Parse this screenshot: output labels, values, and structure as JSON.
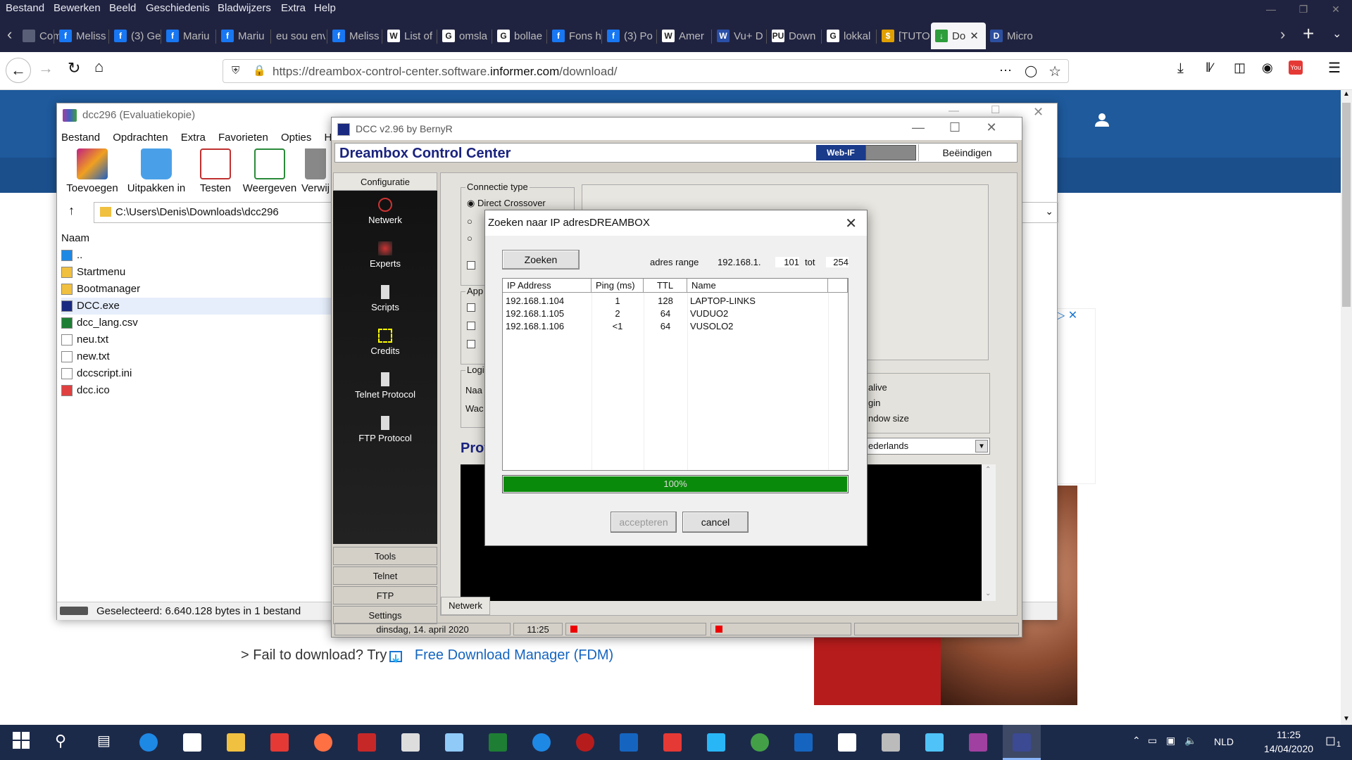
{
  "browser": {
    "menu": [
      "Bestand",
      "Bewerken",
      "Beeld",
      "Geschiedenis",
      "Bladwijzers",
      "Extra",
      "Help"
    ],
    "tabs": [
      {
        "label": "Comp",
        "icon": "page-icon",
        "color": "#5a5f78"
      },
      {
        "label": "Meliss",
        "icon": "facebook-icon",
        "color": "#1877f2"
      },
      {
        "label": "(3) Ge",
        "icon": "facebook-icon",
        "color": "#1877f2"
      },
      {
        "label": "Mariu",
        "icon": "facebook-icon",
        "color": "#1877f2"
      },
      {
        "label": "Mariu",
        "icon": "facebook-icon",
        "color": "#1877f2"
      },
      {
        "label": "eu sou env",
        "icon": "none",
        "color": "#202340"
      },
      {
        "label": "Meliss",
        "icon": "facebook-icon",
        "color": "#1877f2"
      },
      {
        "label": "List of",
        "icon": "wikipedia-icon",
        "color": "#ffffff"
      },
      {
        "label": "omsla",
        "icon": "google-icon",
        "color": "#ffffff"
      },
      {
        "label": "bollae",
        "icon": "google-icon",
        "color": "#ffffff"
      },
      {
        "label": "Fons h",
        "icon": "facebook-icon",
        "color": "#1877f2"
      },
      {
        "label": "(3) Po",
        "icon": "facebook-icon",
        "color": "#1877f2"
      },
      {
        "label": "Amer",
        "icon": "wikipedia-icon",
        "color": "#ffffff"
      },
      {
        "label": "Vu+ D",
        "icon": "vu-icon",
        "color": "#2a4fa8"
      },
      {
        "label": "Down",
        "icon": "pu-icon",
        "color": "#ffffff"
      },
      {
        "label": "lokkal",
        "icon": "google-icon",
        "color": "#ffffff"
      },
      {
        "label": "[TUTO",
        "icon": "coin-icon",
        "color": "#e0a000"
      },
      {
        "label": "Do",
        "icon": "download-icon",
        "color": "#2e9d3c",
        "active": true
      },
      {
        "label": "Micro",
        "icon": "dcc-icon",
        "color": "#2d4fa0"
      }
    ],
    "url_prefix": "https://dreambox-control-center.software.",
    "url_domain": "informer.com",
    "url_path": "/download/"
  },
  "page": {
    "fail_prefix": "> Fail to download? Try",
    "fdm_link": "Free Download Manager (FDM)"
  },
  "winrar": {
    "title": "dcc296 (Evaluatiekopie)",
    "menu": [
      "Bestand",
      "Opdrachten",
      "Extra",
      "Favorieten",
      "Opties",
      "Help"
    ],
    "toolbar": [
      "Toevoegen",
      "Uitpakken in",
      "Testen",
      "Weergeven",
      "Verwij"
    ],
    "path": "C:\\Users\\Denis\\Downloads\\dcc296",
    "column_name": "Naam",
    "files": [
      {
        "name": "..",
        "icon": "up-arrow-icon"
      },
      {
        "name": "Startmenu",
        "icon": "folder-icon"
      },
      {
        "name": "Bootmanager",
        "icon": "folder-icon"
      },
      {
        "name": "DCC.exe",
        "icon": "exe-icon",
        "selected": true
      },
      {
        "name": "dcc_lang.csv",
        "icon": "excel-icon"
      },
      {
        "name": "neu.txt",
        "icon": "text-file-icon"
      },
      {
        "name": "new.txt",
        "icon": "text-file-icon"
      },
      {
        "name": "dccscript.ini",
        "icon": "ini-file-icon"
      },
      {
        "name": "dcc.ico",
        "icon": "image-file-icon"
      }
    ],
    "status": "Geselecteerd: 6.640.128 bytes in 1 bestand"
  },
  "dcc": {
    "title": "DCC v2.96 by BernyR",
    "header": "Dreambox Control Center",
    "webif": "Web-IF",
    "quit": "Beëindigen",
    "sidebar_header": "Configuratie",
    "sidebar": [
      "Netwerk",
      "Experts",
      "Scripts",
      "Credits",
      "Telnet Protocol",
      "FTP Protocol"
    ],
    "bottom_buttons": [
      "Tools",
      "Telnet",
      "FTP",
      "Settings"
    ],
    "tab": "Netwerk",
    "conn_group": "Connectie type",
    "conn_option1": "Direct Crossover",
    "app_group": "App",
    "login_group": "Logi",
    "login_lbl1": "Naa",
    "login_lbl2": "Wac",
    "right_opts": [
      "alive",
      "gin",
      "ndow size"
    ],
    "lang_value": "ederlands",
    "prot_label": "Prot",
    "status_date": "dinsdag, 14. april 2020",
    "status_time": "11:25"
  },
  "dialog": {
    "title": "Zoeken naar IP adresDREAMBOX",
    "search_btn": "Zoeken",
    "range_label": "adres range",
    "range_prefix": "192.168.1.",
    "range_from": "101",
    "range_to_label": "tot",
    "range_to": "254",
    "columns": [
      "IP Address",
      "Ping (ms)",
      "TTL",
      "Name"
    ],
    "rows": [
      {
        "ip": "192.168.1.104",
        "ping": "1",
        "ttl": "128",
        "name": "LAPTOP-LINKS"
      },
      {
        "ip": "192.168.1.105",
        "ping": "2",
        "ttl": "64",
        "name": "VUDUO2"
      },
      {
        "ip": "192.168.1.106",
        "ping": "<1",
        "ttl": "64",
        "name": "VUSOLO2"
      }
    ],
    "progress_text": "100%",
    "progress": 1.0,
    "accept_btn": "accepteren",
    "cancel_btn": "cancel"
  },
  "taskbar": {
    "lang": "NLD",
    "time": "11:25",
    "date": "14/04/2020",
    "notifications": "1"
  }
}
